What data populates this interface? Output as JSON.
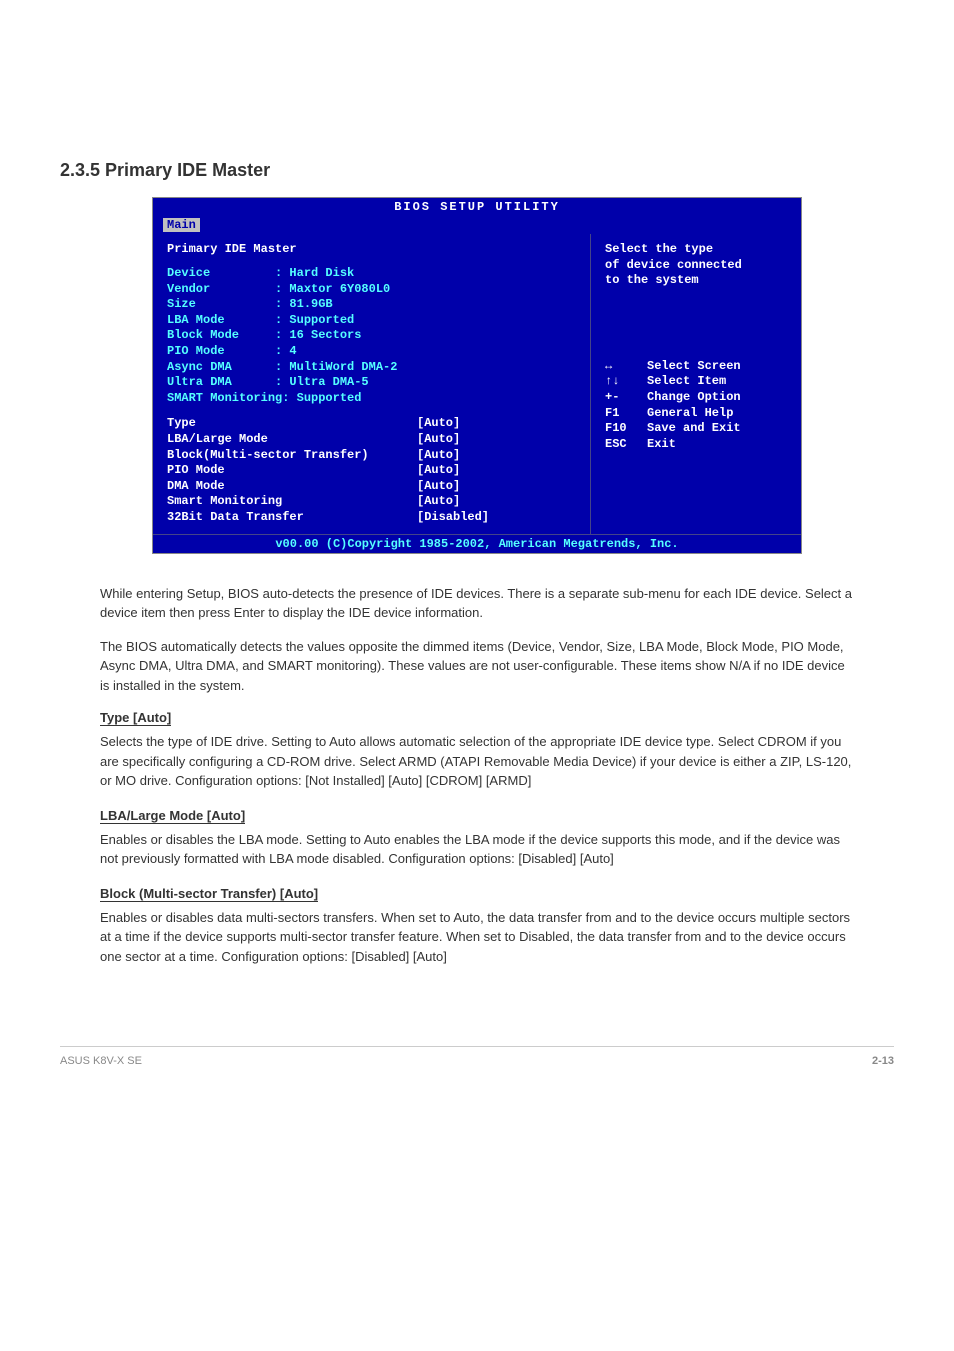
{
  "section_heading": "2.3.5  Primary IDE Master",
  "bios": {
    "title": "BIOS SETUP UTILITY",
    "tab": "Main",
    "panel_title": "Primary IDE Master",
    "info_rows": [
      "Device         : Hard Disk",
      "Vendor         : Maxtor 6Y080L0",
      "Size           : 81.9GB",
      "LBA Mode       : Supported",
      "Block Mode     : 16 Sectors",
      "PIO Mode       : 4",
      "Async DMA      : MultiWord DMA-2",
      "Ultra DMA      : Ultra DMA-5",
      "SMART Monitoring: Supported"
    ],
    "settings": [
      {
        "label": "Type",
        "value": "[Auto]"
      },
      {
        "label": "LBA/Large Mode",
        "value": "[Auto]"
      },
      {
        "label": "Block(Multi-sector Transfer)",
        "value": "[Auto]"
      },
      {
        "label": "PIO Mode",
        "value": "[Auto]"
      },
      {
        "label": "DMA Mode",
        "value": "[Auto]"
      },
      {
        "label": "Smart Monitoring",
        "value": "[Auto]"
      },
      {
        "label": "32Bit Data Transfer",
        "value": "[Disabled]"
      }
    ],
    "help_lines": [
      "Select the type",
      "of device connected",
      "to the system"
    ],
    "nav": [
      {
        "key": "↔",
        "label": "Select Screen"
      },
      {
        "key": "↑↓",
        "label": "Select Item"
      },
      {
        "key": "+-",
        "label": "Change Option"
      },
      {
        "key": "F1",
        "label": "General Help"
      },
      {
        "key": "F10",
        "label": "Save and Exit"
      },
      {
        "key": "ESC",
        "label": "Exit"
      }
    ],
    "footer": "v00.00 (C)Copyright 1985-2002, American Megatrends, Inc."
  },
  "intro_para": "While entering Setup, BIOS auto-detects the presence of IDE devices. There is a separate sub-menu for each IDE device. Select a device item then press Enter to display the IDE device information.",
  "bios_auto_para": "The BIOS automatically detects the values opposite the dimmed items (Device, Vendor, Size, LBA Mode, Block Mode, PIO Mode, Async DMA, Ultra DMA, and SMART monitoring). These values are not user-configurable. These items show N/A if no IDE device is installed in the system.",
  "type_heading": "Type [Auto]",
  "type_para": "Selects the type of IDE drive. Setting to Auto allows automatic selection of the appropriate IDE device type. Select CDROM if you are specifically configuring a CD-ROM drive. Select ARMD (ATAPI Removable Media Device) if your device is either a ZIP, LS-120, or MO drive. Configuration options: [Not Installed] [Auto] [CDROM] [ARMD]",
  "lba_heading": "LBA/Large Mode [Auto]",
  "lba_para": "Enables or disables the LBA mode. Setting to Auto enables the LBA mode if the device supports this mode, and if the device was not previously formatted with LBA mode disabled. Configuration options: [Disabled] [Auto]",
  "block_heading": "Block (Multi-sector Transfer) [Auto]",
  "block_para": "Enables or disables data multi-sectors transfers. When set to Auto, the data transfer from and to the device occurs multiple sectors at a time if the device supports multi-sector transfer feature. When set to Disabled, the data transfer from and to the device occurs one sector at a time. Configuration options: [Disabled] [Auto]",
  "footer_left": "ASUS K8V-X SE",
  "footer_right": "2-13"
}
